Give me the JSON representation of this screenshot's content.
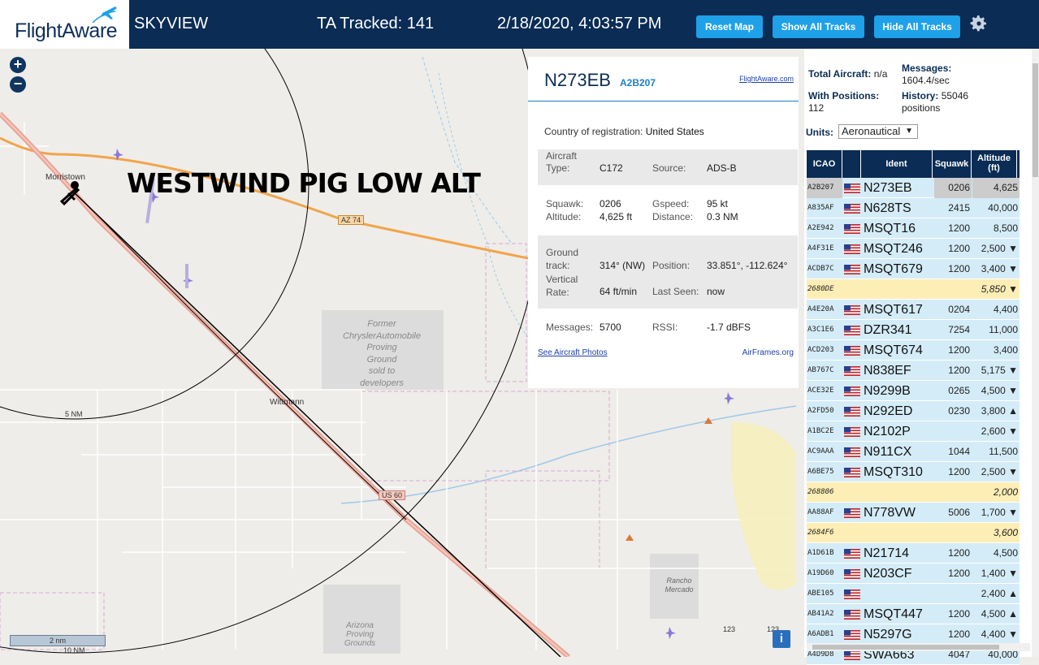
{
  "header": {
    "logo": "FlightAware",
    "app_name": "SKYVIEW",
    "tracked_label": "TA Tracked: 141",
    "datetime": "2/18/2020, 4:03:57 PM",
    "buttons": {
      "reset": "Reset Map",
      "show": "Show All Tracks",
      "hide": "Hide All Tracks"
    },
    "settings_icon": "gear-icon"
  },
  "map": {
    "overlay_title": "WESTWIND PIG LOW ALT",
    "zoom_in": "+",
    "zoom_out": "−",
    "labels": {
      "morristown": "Morristown",
      "az74": "AZ 74",
      "wittmann": "Wittmann",
      "us60": "US 60",
      "ring5": "5 NM",
      "ring10": "10 NM",
      "chrysler": [
        "Former",
        "ChryslerAutomobile",
        "Proving",
        "Ground",
        "sold to",
        "developers"
      ],
      "rancho": [
        "Rancho",
        "Mercado"
      ],
      "arizona": [
        "Arizona",
        "Proving",
        "Grounds"
      ],
      "road123a": "123",
      "road123b": "123"
    },
    "scale_2nm": "2 nm",
    "info": "i"
  },
  "selected": {
    "ident": "N273EB",
    "icao": "A2B207",
    "fa_link": "FlightAware.com",
    "country_label": "Country of registration:",
    "country_value": "United States",
    "aircraft_type_label_1": "Aircraft",
    "aircraft_type_label_2": "Type:",
    "aircraft_type": "C172",
    "source_label": "Source:",
    "source": "ADS-B",
    "squawk_label": "Squawk:",
    "squawk": "0206",
    "gspeed_label": "Gspeed:",
    "gspeed": "95 kt",
    "altitude_label": "Altitude:",
    "altitude": "4,625 ft",
    "distance_label": "Distance:",
    "distance": "0.3 NM",
    "track_label_1": "Ground",
    "track_label_2": "track:",
    "track": "314° (NW)",
    "position_label": "Position:",
    "position": "33.851°, -112.624°",
    "vrate_label_1": "Vertical",
    "vrate_label_2": "Rate:",
    "vrate": "64 ft/min",
    "lastseen_label": "Last Seen:",
    "lastseen": "now",
    "messages_label": "Messages:",
    "messages": "5700",
    "rssi_label": "RSSI:",
    "rssi": "-1.7 dBFS",
    "photos_link": "See Aircraft Photos",
    "airframes_link": "AirFrames.org"
  },
  "stats": {
    "total_label": "Total Aircraft:",
    "total": "n/a",
    "messages_label": "Messages:",
    "messages": "1604.4/sec",
    "withpos_label": "With Positions:",
    "withpos": "112",
    "history_label": "History:",
    "history": "55046",
    "history_unit": "positions",
    "units_label": "Units:",
    "units_value": "Aeronautical"
  },
  "table": {
    "headers": {
      "icao": "ICAO",
      "ident": "Ident",
      "squawk": "Squawk",
      "alt1": "Altitude",
      "alt2": "(ft)"
    },
    "rows": [
      {
        "icao": "A2B207",
        "flag": true,
        "ident": "N273EB",
        "squawk": "0206",
        "alt": "4,625",
        "style": "sel"
      },
      {
        "icao": "A835AF",
        "flag": true,
        "ident": "N628TS",
        "squawk": "2415",
        "alt": "40,000",
        "style": "blue"
      },
      {
        "icao": "A2E942",
        "flag": true,
        "ident": "MSQT16",
        "squawk": "1200",
        "alt": "8,500",
        "style": "blue"
      },
      {
        "icao": "A4F31E",
        "flag": true,
        "ident": "MSQT246",
        "squawk": "1200",
        "alt": "2,500 ▼",
        "style": "blue"
      },
      {
        "icao": "ACDB7C",
        "flag": true,
        "ident": "MSQT679",
        "squawk": "1200",
        "alt": "3,400 ▼",
        "style": "blue"
      },
      {
        "icao": "2680DE",
        "flag": false,
        "ident": "",
        "squawk": "",
        "alt": "5,850 ▼",
        "style": "yel"
      },
      {
        "icao": "A4E20A",
        "flag": true,
        "ident": "MSQT617",
        "squawk": "0204",
        "alt": "4,400",
        "style": "blue"
      },
      {
        "icao": "A3C1E6",
        "flag": true,
        "ident": "DZR341",
        "squawk": "7254",
        "alt": "11,000",
        "style": "blue"
      },
      {
        "icao": "ACD203",
        "flag": true,
        "ident": "MSQT674",
        "squawk": "1200",
        "alt": "3,400",
        "style": "blue"
      },
      {
        "icao": "AB767C",
        "flag": true,
        "ident": "N838EF",
        "squawk": "1200",
        "alt": "5,175 ▼",
        "style": "blue"
      },
      {
        "icao": "ACE32E",
        "flag": true,
        "ident": "N9299B",
        "squawk": "0265",
        "alt": "4,500 ▼",
        "style": "blue"
      },
      {
        "icao": "A2FD50",
        "flag": true,
        "ident": "N292ED",
        "squawk": "0230",
        "alt": "3,800 ▲",
        "style": "blue"
      },
      {
        "icao": "A1BC2E",
        "flag": true,
        "ident": "N2102P",
        "squawk": "",
        "alt": "2,600 ▼",
        "style": "blue"
      },
      {
        "icao": "AC9AAA",
        "flag": true,
        "ident": "N911CX",
        "squawk": "1044",
        "alt": "11,500",
        "style": "blue"
      },
      {
        "icao": "A6BE75",
        "flag": true,
        "ident": "MSQT310",
        "squawk": "1200",
        "alt": "2,500 ▼",
        "style": "blue"
      },
      {
        "icao": "268806",
        "flag": false,
        "ident": "",
        "squawk": "",
        "alt": "2,000",
        "style": "yel"
      },
      {
        "icao": "AA88AF",
        "flag": true,
        "ident": "N778VW",
        "squawk": "5006",
        "alt": "1,700 ▼",
        "style": "blue"
      },
      {
        "icao": "2684F6",
        "flag": false,
        "ident": "",
        "squawk": "",
        "alt": "3,600",
        "style": "yel"
      },
      {
        "icao": "A1D61B",
        "flag": true,
        "ident": "N21714",
        "squawk": "1200",
        "alt": "4,500",
        "style": "blue"
      },
      {
        "icao": "A19D60",
        "flag": true,
        "ident": "N203CF",
        "squawk": "1200",
        "alt": "1,400 ▼",
        "style": "blue"
      },
      {
        "icao": "ABE105",
        "flag": true,
        "ident": "",
        "squawk": "",
        "alt": "2,400 ▲",
        "style": "blue"
      },
      {
        "icao": "AB41A2",
        "flag": true,
        "ident": "MSQT447",
        "squawk": "1200",
        "alt": "4,500 ▲",
        "style": "blue"
      },
      {
        "icao": "A6ADB1",
        "flag": true,
        "ident": "N5297G",
        "squawk": "1200",
        "alt": "4,400 ▼",
        "style": "blue"
      },
      {
        "icao": "A4D9D8",
        "flag": true,
        "ident": "SWA663",
        "squawk": "4047",
        "alt": "40,000",
        "style": "blue"
      }
    ]
  },
  "colors": {
    "header_bg": "#0a2c55",
    "button_bg": "#1ea1e8",
    "row_blue": "#d4ecf7",
    "row_yellow": "#fdeeb5"
  }
}
